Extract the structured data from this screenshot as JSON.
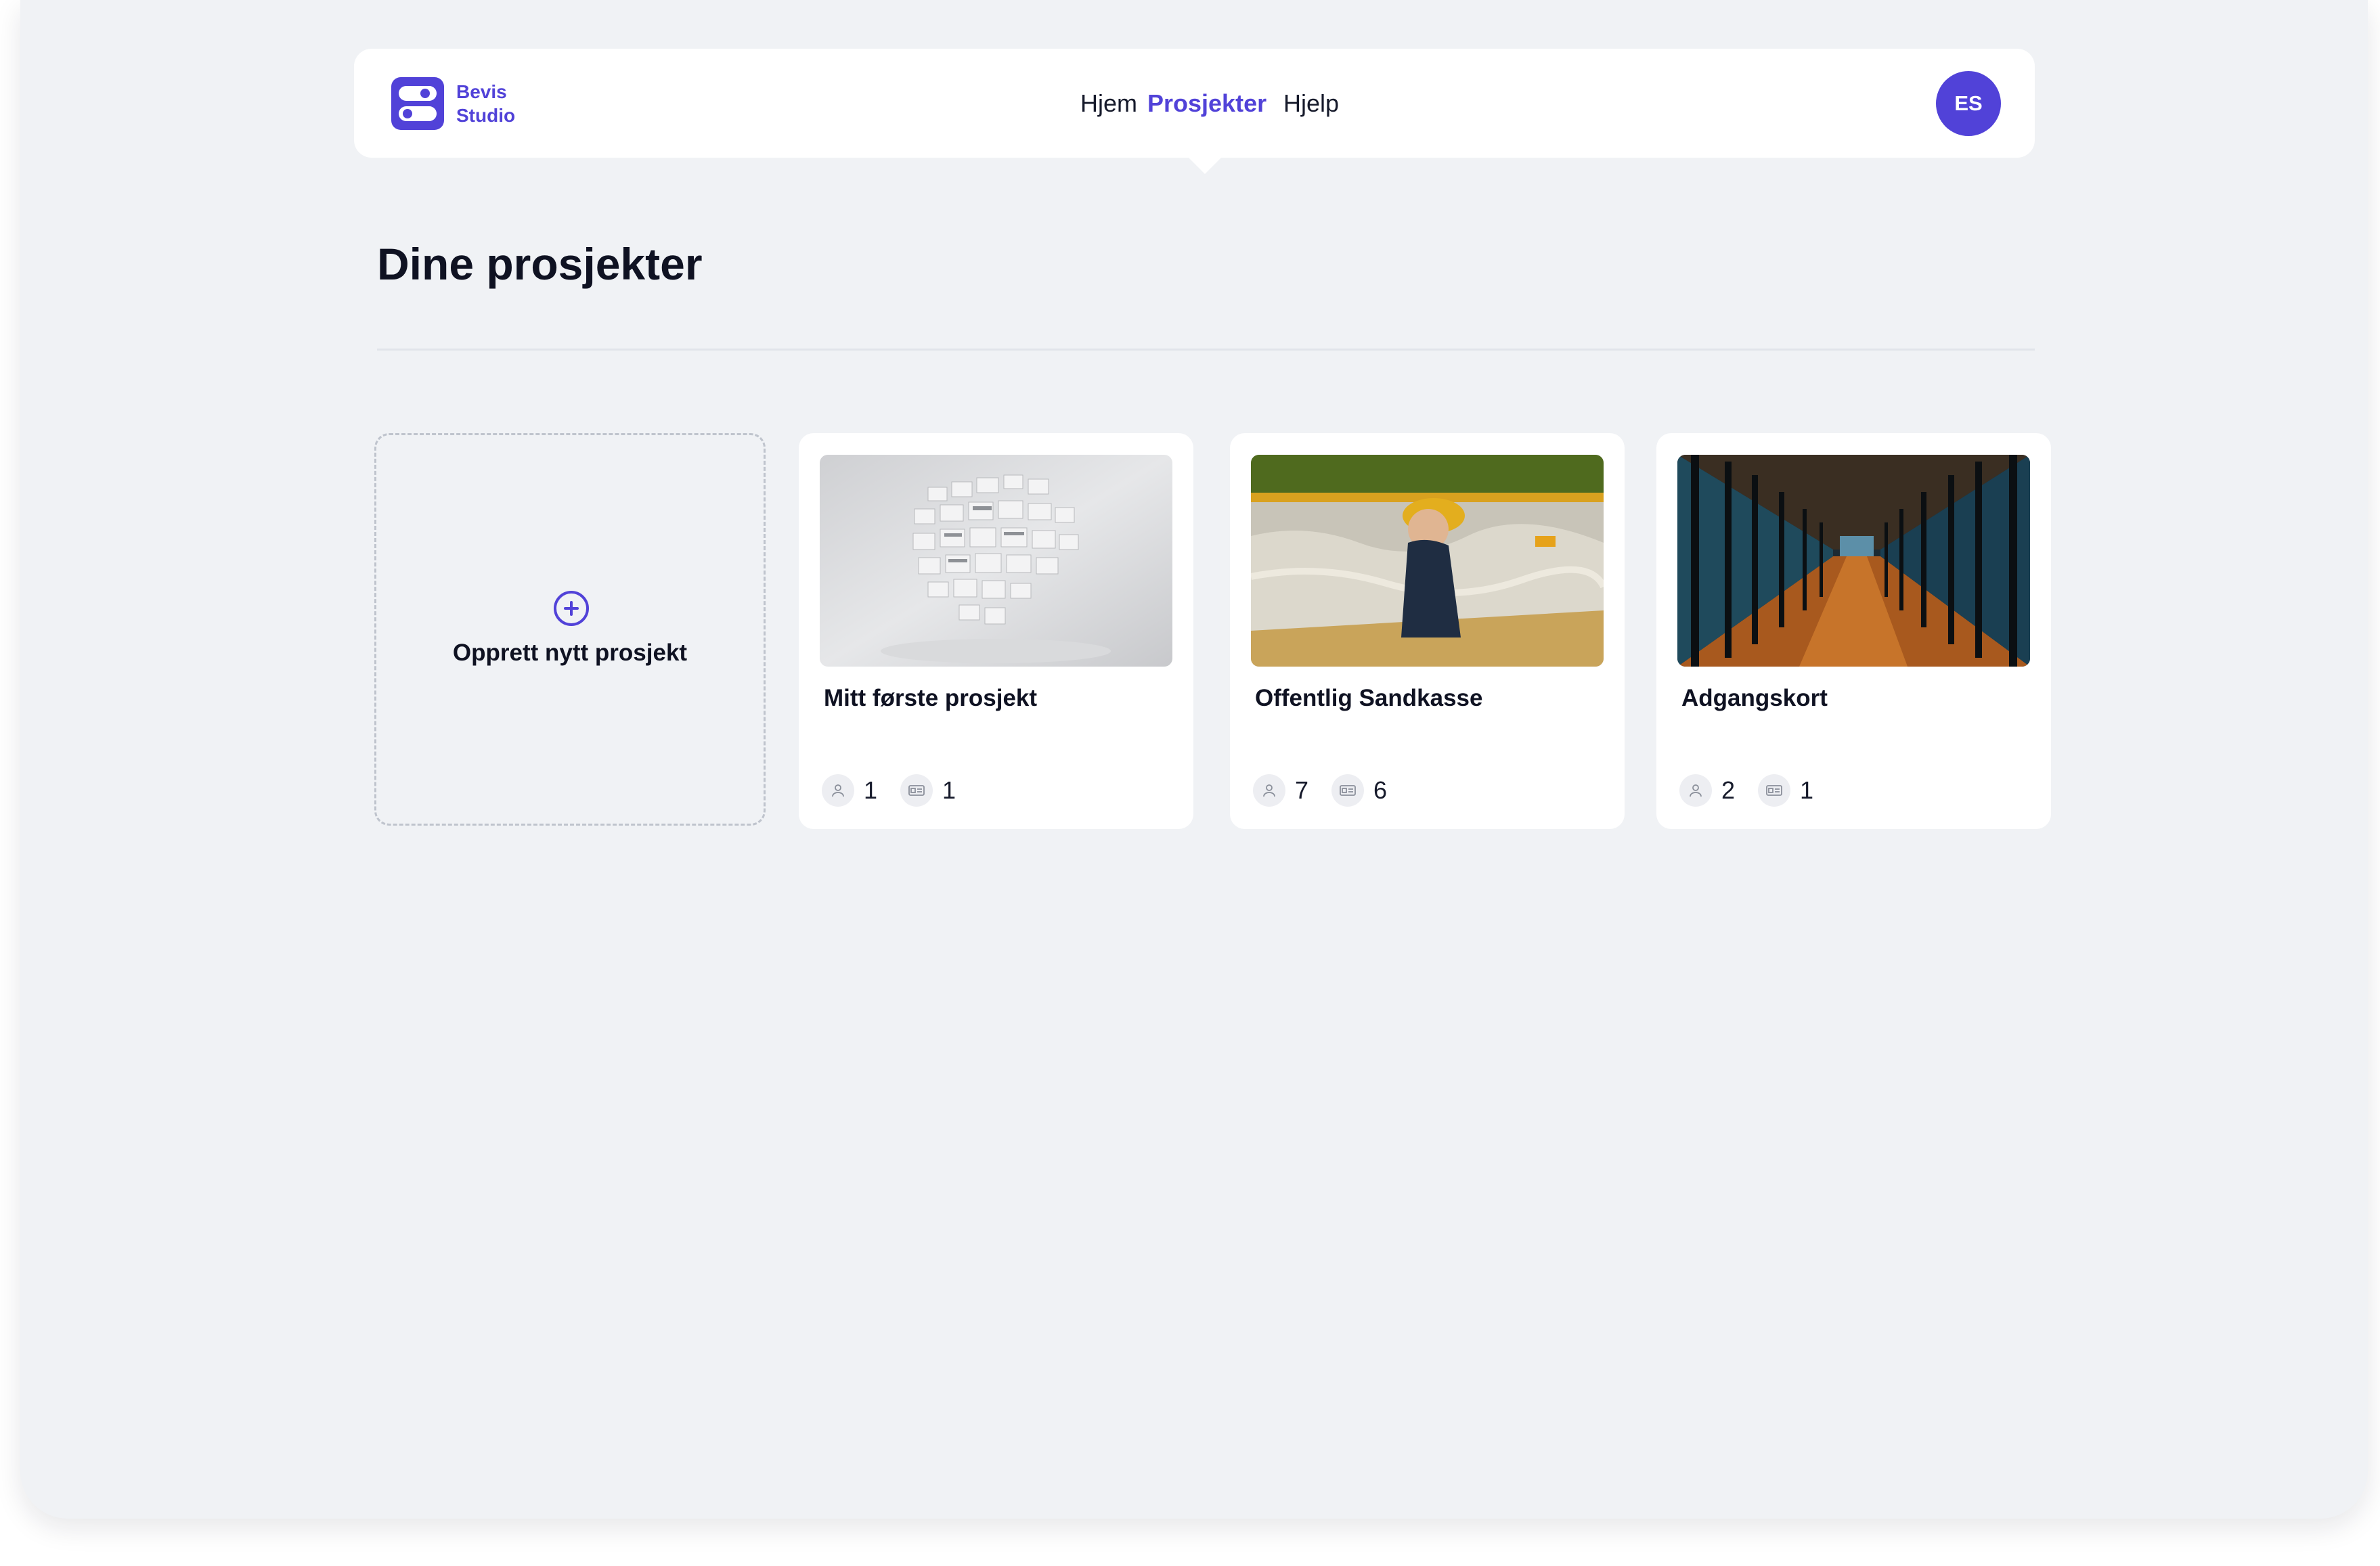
{
  "brand": {
    "line1": "Bevis",
    "line2": "Studio",
    "accent": "#5142d8"
  },
  "nav": {
    "items": [
      {
        "label": "Hjem",
        "active": false
      },
      {
        "label": "Prosjekter",
        "active": true
      },
      {
        "label": "Hjelp",
        "active": false
      }
    ],
    "avatar_initials": "ES"
  },
  "page": {
    "title": "Dine prosjekter"
  },
  "new_project": {
    "label": "Opprett nytt prosjekt",
    "icon": "plus-circle-icon"
  },
  "projects": [
    {
      "title": "Mitt første prosjekt",
      "image": "floating-cards-image",
      "members": "1",
      "credentials": "1"
    },
    {
      "title": "Offentlig Sandkasse",
      "image": "child-in-sandbox-image",
      "members": "7",
      "credentials": "6"
    },
    {
      "title": "Adgangskort",
      "image": "office-corridor-image",
      "members": "2",
      "credentials": "1"
    }
  ],
  "icons": {
    "members": "user-icon",
    "credentials": "id-card-icon"
  }
}
